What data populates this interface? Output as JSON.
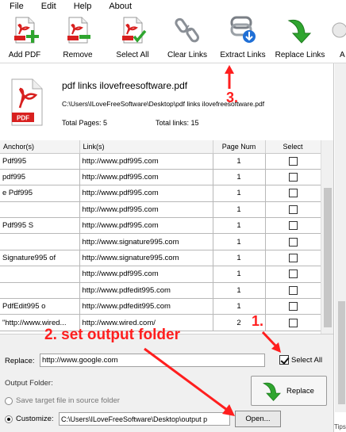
{
  "menu": [
    "File",
    "Edit",
    "Help",
    "About"
  ],
  "toolbar": {
    "buttons": [
      {
        "label": "Add PDF",
        "icon": "pdf-add-icon"
      },
      {
        "label": "Remove",
        "icon": "pdf-remove-icon"
      },
      {
        "label": "Select All",
        "icon": "pdf-select-all-icon"
      },
      {
        "label": "Clear Links",
        "icon": "chain-break-icon"
      },
      {
        "label": "Extract Links",
        "icon": "extract-links-icon"
      },
      {
        "label": "Replace Links",
        "icon": "green-arrow-icon"
      },
      {
        "label": "A",
        "icon": "about-icon"
      }
    ]
  },
  "info": {
    "file_name": "pdf links ilovefreesoftware.pdf",
    "path": "C:\\Users\\ILoveFreeSoftware\\Desktop\\pdf links ilovefreesoftware.pdf",
    "total_pages": "Total Pages: 5",
    "total_links": "Total links: 15"
  },
  "table": {
    "headers": [
      "Anchor(s)",
      "Link(s)",
      "Page Num",
      "Select"
    ],
    "rows": [
      {
        "anchor": "Pdf995",
        "link": "http://www.pdf995.com",
        "page": "1"
      },
      {
        "anchor": "pdf995",
        "link": "http://www.pdf995.com",
        "page": "1"
      },
      {
        "anchor": "e Pdf995",
        "link": "http://www.pdf995.com",
        "page": "1"
      },
      {
        "anchor": "",
        "link": "http://www.pdf995.com",
        "page": "1"
      },
      {
        "anchor": "Pdf995 S",
        "link": "http://www.pdf995.com",
        "page": "1"
      },
      {
        "anchor": "",
        "link": "http://www.signature995.com",
        "page": "1"
      },
      {
        "anchor": "Signature995 of",
        "link": "http://www.signature995.com",
        "page": "1"
      },
      {
        "anchor": "",
        "link": "http://www.pdf995.com",
        "page": "1"
      },
      {
        "anchor": "",
        "link": "http://www.pdfedit995.com",
        "page": "1"
      },
      {
        "anchor": "PdfEdit995 o",
        "link": "http://www.pdfedit995.com",
        "page": "1"
      },
      {
        "anchor": "\"http://www.wired...",
        "link": "http://www.wired.com/",
        "page": "2"
      }
    ]
  },
  "bottom": {
    "replace_label": "Replace:",
    "replace_value": "http://www.google.com",
    "select_all_label": "Select All",
    "output_folder_label": "Output Folder:",
    "save_source_label": "Save target file in source folder",
    "customize_label": "Customize:",
    "output_path": "C:\\Users\\ILoveFreeSoftware\\Desktop\\output p",
    "open_label": "Open...",
    "replace_button_label": "Replace",
    "tips_label": "Tips"
  },
  "annotations": {
    "step1": "1.",
    "step2": "2. set output folder",
    "step3": "3."
  },
  "colors": {
    "annotation": "#ff1e1e",
    "pdf_red": "#d8201f",
    "green": "#2fa52f"
  }
}
